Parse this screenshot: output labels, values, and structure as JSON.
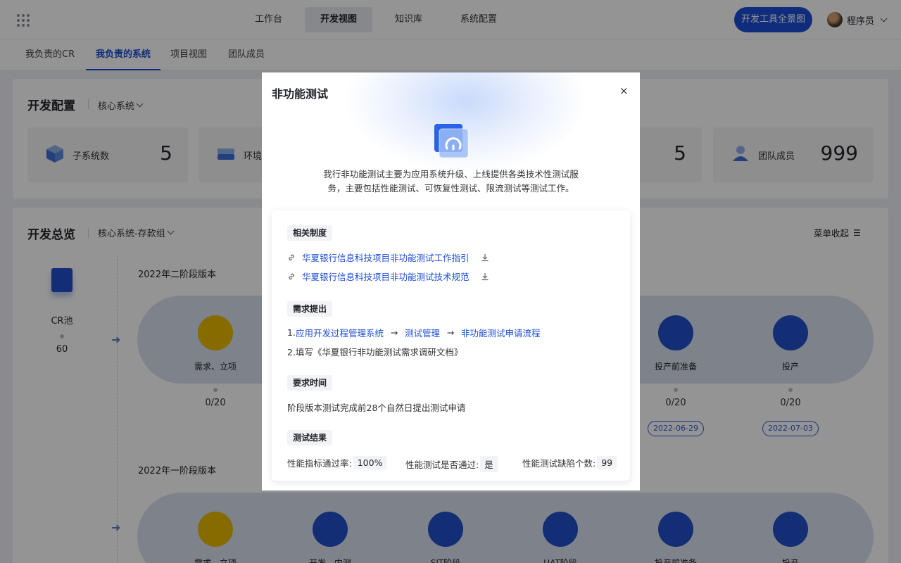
{
  "topnav": {
    "tabs": [
      "工作台",
      "开发视图",
      "知识库",
      "系统配置"
    ],
    "active_tab": "开发视图",
    "overview_button": "开发工具全景图",
    "user_name": "程序员"
  },
  "subnav": {
    "tabs": [
      "我负责的CR",
      "我负责的系统",
      "项目视图",
      "团队成员"
    ],
    "active_tab": "我负责的系统"
  },
  "dev_config": {
    "title": "开发配置",
    "selector": "核心系统",
    "cards": [
      {
        "label": "子系统数",
        "value": "5"
      },
      {
        "label": "环境",
        "value": ""
      },
      {
        "label": "",
        "value": "5"
      },
      {
        "label": "团队成员",
        "value": "999"
      }
    ]
  },
  "dev_overview": {
    "title": "开发总览",
    "selector": "核心系统-存款组",
    "collapse_menu": "菜单收起",
    "cr_pool": {
      "label": "CR池",
      "count": "60"
    },
    "release_1": {
      "title": "2022年二阶段版本",
      "stages": [
        {
          "label": "需求、立项",
          "count": "0/20"
        },
        {
          "label": "投产前准备",
          "count": "0/20",
          "date": "2022-06-29"
        },
        {
          "label": "投产",
          "count": "0/20",
          "date": "2022-07-03"
        }
      ]
    },
    "release_2": {
      "title": "2022年一阶段版本",
      "stages": [
        {
          "label": "需求、立项"
        },
        {
          "label": "开发、内测"
        },
        {
          "label": "SIT阶段"
        },
        {
          "label": "UAT阶段"
        },
        {
          "label": "投产前准备"
        },
        {
          "label": "投产"
        }
      ]
    }
  },
  "modal": {
    "title": "非功能测试",
    "close": "×",
    "description": "我行非功能测试主要为应用系统升级、上线提供各类技术性测试服务，主要包括性能测试、可恢复性测试、限流测试等测试工作。",
    "sections": {
      "regulations": {
        "tag": "相关制度",
        "docs": [
          "华夏银行信息科技项目非功能测试工作指引",
          "华夏银行信息科技项目非功能测试技术规范"
        ]
      },
      "request": {
        "tag": "需求提出",
        "step1_prefix": "1.",
        "step1_links": [
          "应用开发过程管理系统",
          "测试管理",
          "非功能测试申请流程"
        ],
        "arrow": "→",
        "step2": "2.填写《华夏银行非功能测试需求调研文档》"
      },
      "timing": {
        "tag": "要求时间",
        "text": "阶段版本测试完成前28个自然日提出测试申请"
      },
      "results": {
        "tag": "测试结果",
        "items": [
          {
            "label": "性能指标通过率:",
            "value": "100%"
          },
          {
            "label": "性能测试是否通过:",
            "value": "是"
          },
          {
            "label": "性能测试缺陷个数:",
            "value": "99"
          }
        ]
      }
    }
  },
  "colors": {
    "primary": "#1d4ed8",
    "stage_yellow": "#e6b800",
    "stage_blue": "#2150c8",
    "pipeline_bg": "#d9e1f0"
  }
}
